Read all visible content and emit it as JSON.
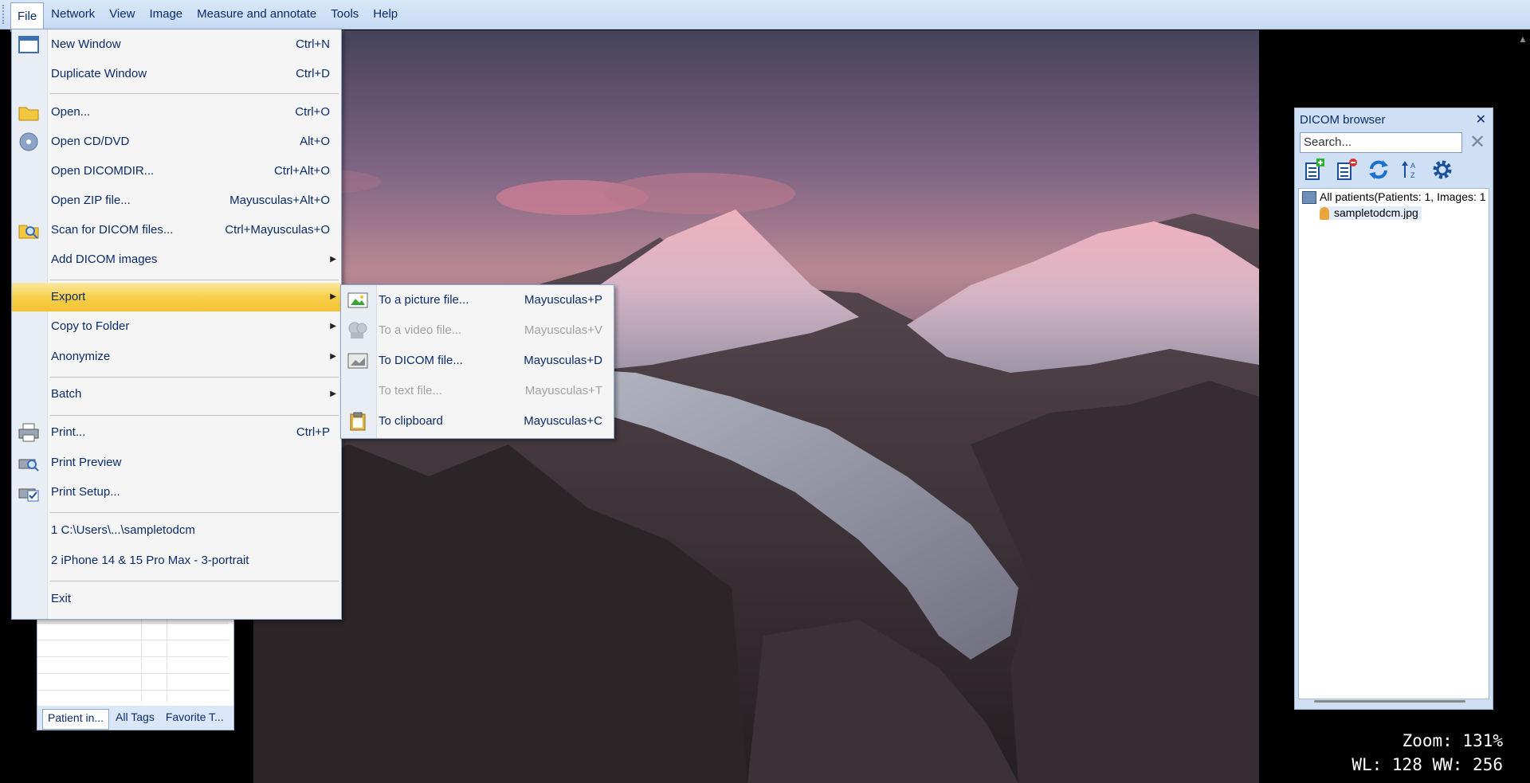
{
  "menubar": {
    "items": [
      "File",
      "Network",
      "View",
      "Image",
      "Measure and annotate",
      "Tools",
      "Help"
    ]
  },
  "file_menu": {
    "items": [
      {
        "label": "New Window",
        "shortcut": "Ctrl+N",
        "icon": "window-icon"
      },
      {
        "label": "Duplicate Window",
        "shortcut": "Ctrl+D"
      },
      {
        "label": "Open...",
        "shortcut": "Ctrl+O",
        "icon": "folder-icon"
      },
      {
        "label": "Open CD/DVD",
        "shortcut": "Alt+O",
        "icon": "cd-icon"
      },
      {
        "label": "Open DICOMDIR...",
        "shortcut": "Ctrl+Alt+O"
      },
      {
        "label": "Open ZIP file...",
        "shortcut": "Mayusculas+Alt+O"
      },
      {
        "label": "Scan for DICOM files...",
        "shortcut": "Ctrl+Mayusculas+O",
        "icon": "scan-icon"
      },
      {
        "label": "Add DICOM images",
        "submenu": true
      },
      {
        "label": "Export",
        "submenu": true,
        "highlighted": true
      },
      {
        "label": "Copy to Folder",
        "submenu": true
      },
      {
        "label": "Anonymize",
        "submenu": true
      },
      {
        "label": "Batch",
        "submenu": true
      },
      {
        "label": "Print...",
        "shortcut": "Ctrl+P",
        "icon": "printer-icon"
      },
      {
        "label": "Print Preview",
        "icon": "print-preview-icon"
      },
      {
        "label": "Print Setup...",
        "icon": "print-setup-icon"
      },
      {
        "label": "1 C:\\Users\\...\\sampletodcm"
      },
      {
        "label": "2 iPhone 14 & 15 Pro Max - 3-portrait"
      },
      {
        "label": "Exit"
      }
    ]
  },
  "export_submenu": {
    "items": [
      {
        "label": "To a picture file...",
        "shortcut": "Mayusculas+P",
        "enabled": true,
        "icon": "picture-icon"
      },
      {
        "label": "To a video file...",
        "shortcut": "Mayusculas+V",
        "enabled": false,
        "icon": "film-reel-icon"
      },
      {
        "label": "To DICOM file...",
        "shortcut": "Mayusculas+D",
        "enabled": true,
        "icon": "dicom-file-icon"
      },
      {
        "label": "To text file...",
        "shortcut": "Mayusculas+T",
        "enabled": false
      },
      {
        "label": "To clipboard",
        "shortcut": "Mayusculas+C",
        "enabled": true,
        "icon": "clipboard-icon"
      }
    ]
  },
  "left_panel": {
    "tabs": [
      "Patient in...",
      "All Tags",
      "Favorite T..."
    ]
  },
  "dicom_browser": {
    "title": "DICOM browser",
    "search_placeholder": "Search...",
    "tree": {
      "root": "All patients(Patients: 1, Images: 1",
      "child": "sampletodcm.jpg"
    }
  },
  "overlay": {
    "zoom": "Zoom: 131%",
    "wl_ww": "WL: 128 WW: 256"
  }
}
